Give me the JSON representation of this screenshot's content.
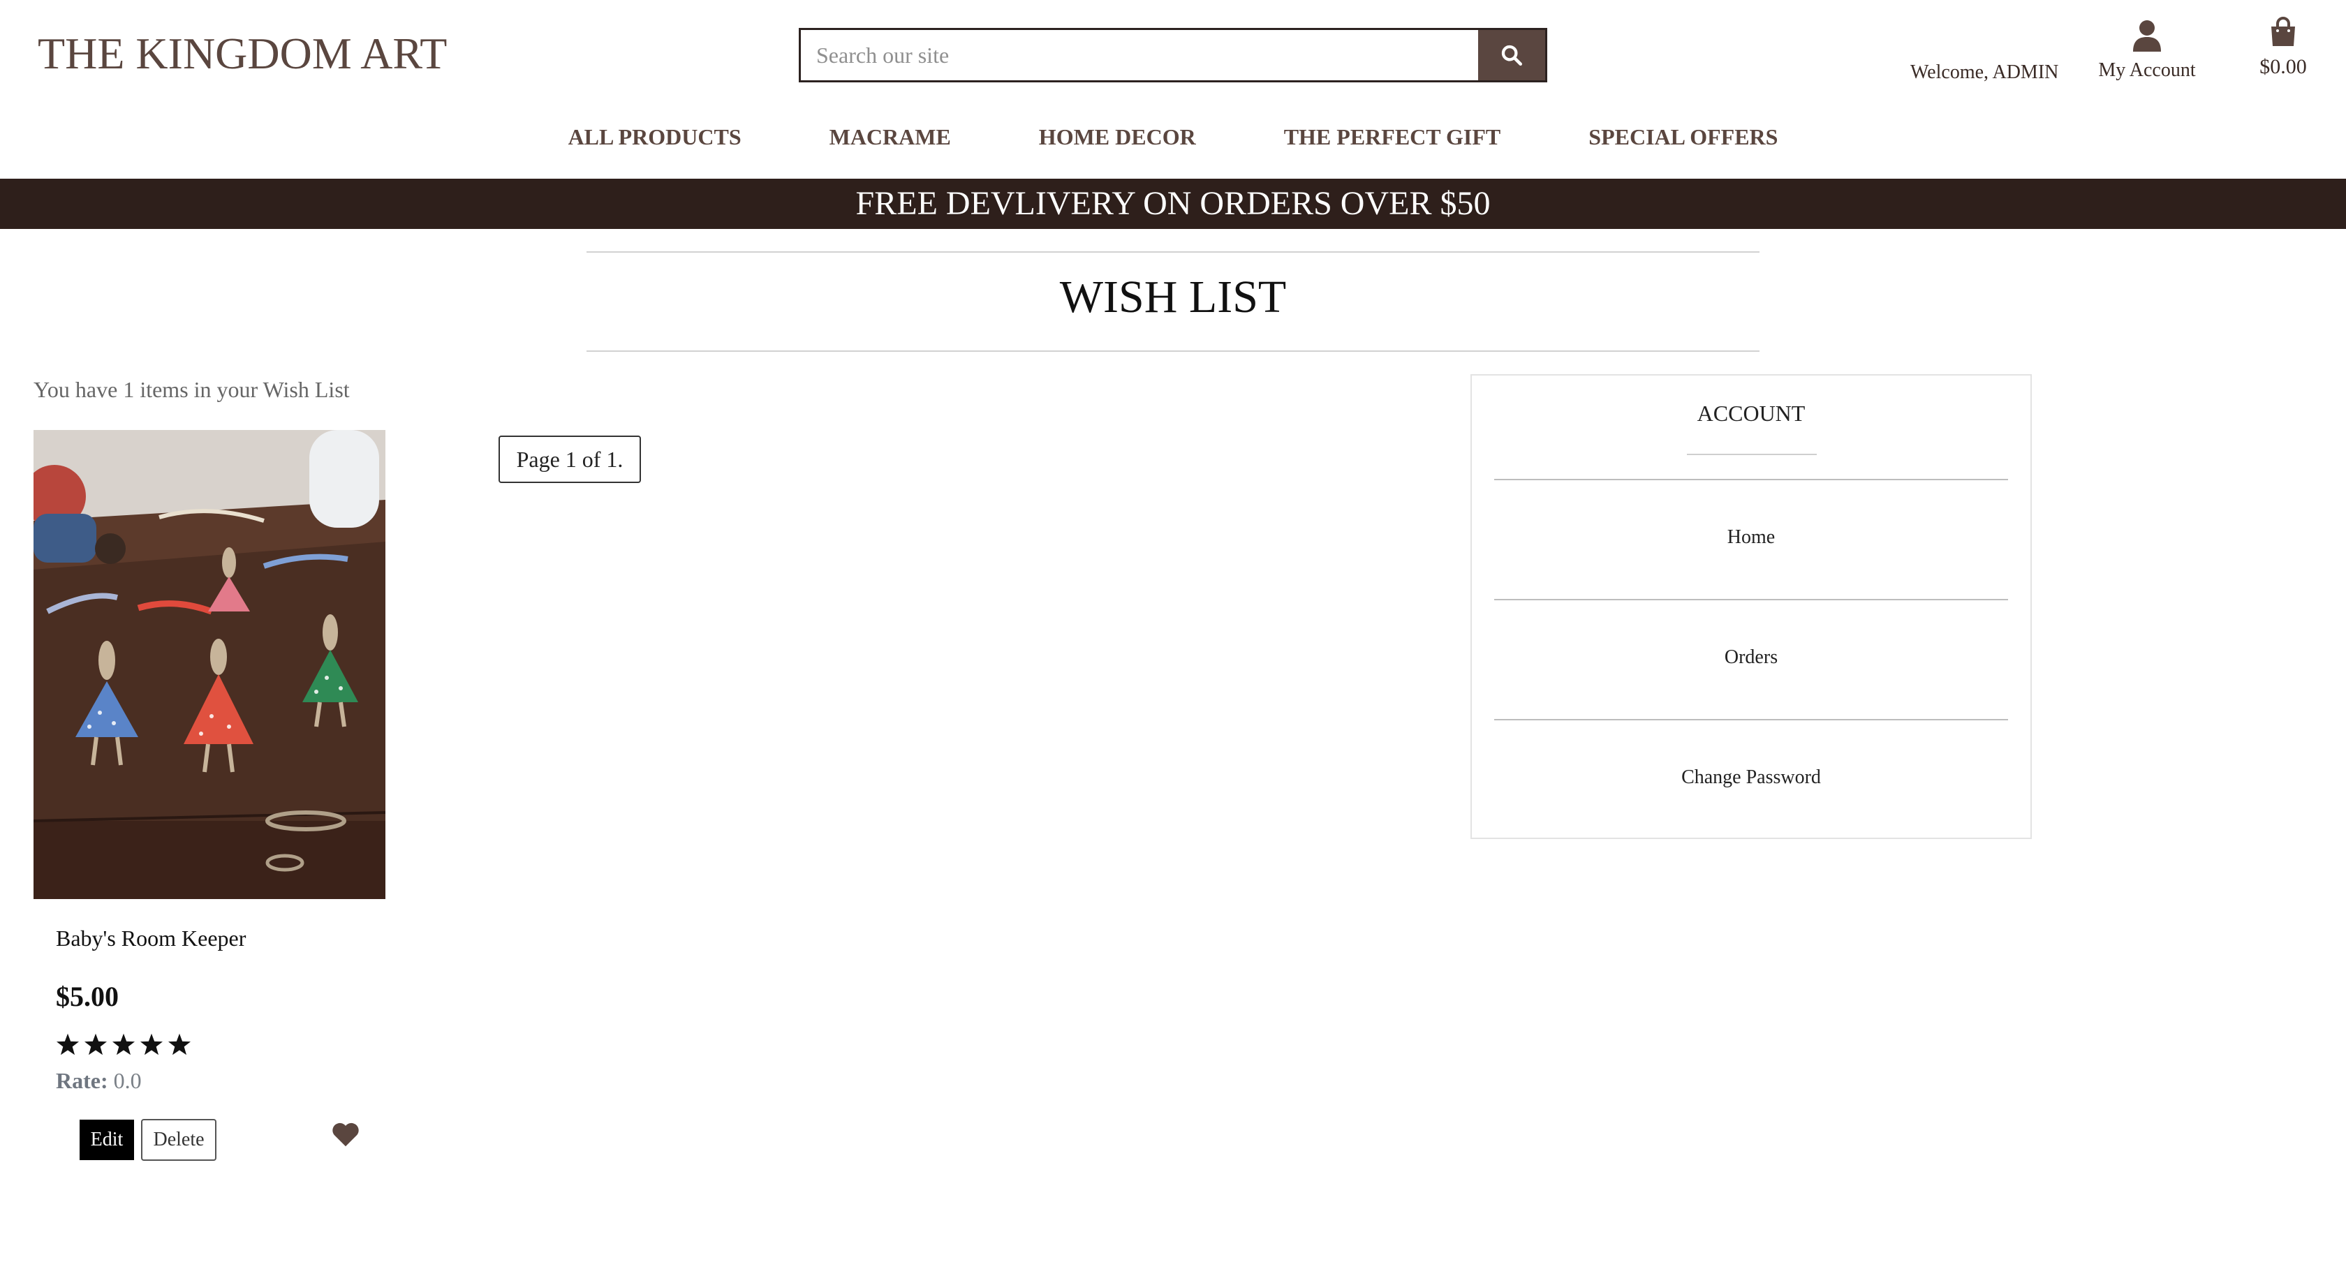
{
  "header": {
    "logo": "THE KINGDOM ART",
    "search_placeholder": "Search our site",
    "welcome": "Welcome, ADMIN",
    "account_label": "My Account",
    "cart_total": "$0.00"
  },
  "nav": [
    "ALL PRODUCTS",
    "MACRAME",
    "HOME DECOR",
    "THE PERFECT GIFT",
    "SPECIAL OFFERS"
  ],
  "banner": "FREE DEVLIVERY ON ORDERS OVER $50",
  "page_title": "WISH LIST",
  "count_text": "You have 1 items in your Wish List",
  "pagination": "Page 1 of 1.",
  "product": {
    "name": "Baby's Room Keeper",
    "price": "$5.00",
    "stars": 5,
    "rate_label": "Rate:",
    "rate_value": "0.0",
    "edit": "Edit",
    "delete": "Delete"
  },
  "account_panel": {
    "title": "ACCOUNT",
    "links": [
      "Home",
      "Orders",
      "Change Password"
    ]
  },
  "colors": {
    "brand": "#5a463f",
    "banner": "#2e1f1b"
  }
}
